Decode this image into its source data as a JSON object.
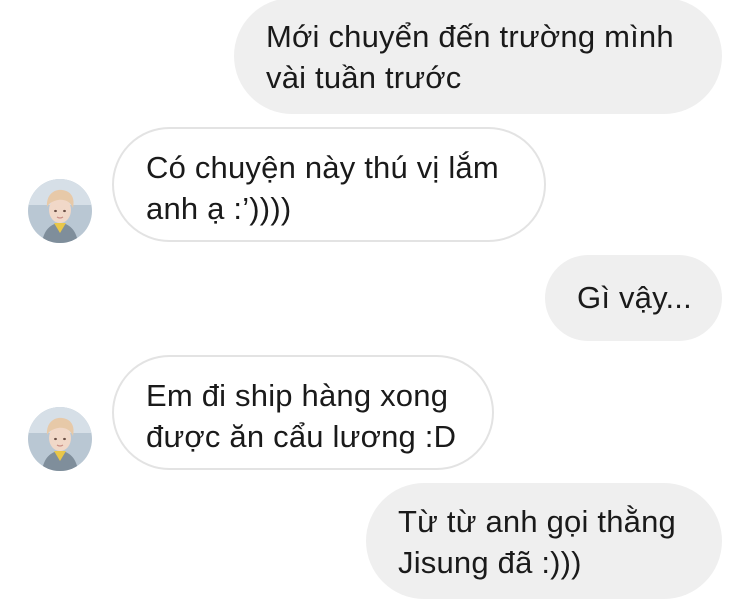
{
  "messages": [
    {
      "direction": "sent",
      "lines": [
        "Mới chuyển đến trường mình",
        "vài tuần trước"
      ]
    },
    {
      "direction": "received",
      "lines": [
        "Có chuyện này thú vị lắm",
        "anh ạ :’))))"
      ]
    },
    {
      "direction": "sent",
      "lines": [
        "Gì vậy..."
      ]
    },
    {
      "direction": "received",
      "lines": [
        "Em đi ship hàng xong",
        "được ăn cẩu lương :D"
      ]
    },
    {
      "direction": "sent",
      "lines": [
        "Từ từ anh gọi thằng",
        "Jisung đã :)))"
      ]
    }
  ],
  "colors": {
    "sent_bubble": "#efefef",
    "received_bubble": "#ffffff",
    "received_border": "#e3e3e3",
    "text": "#1a1a1a"
  },
  "avatar_icon": "avatar-photo"
}
